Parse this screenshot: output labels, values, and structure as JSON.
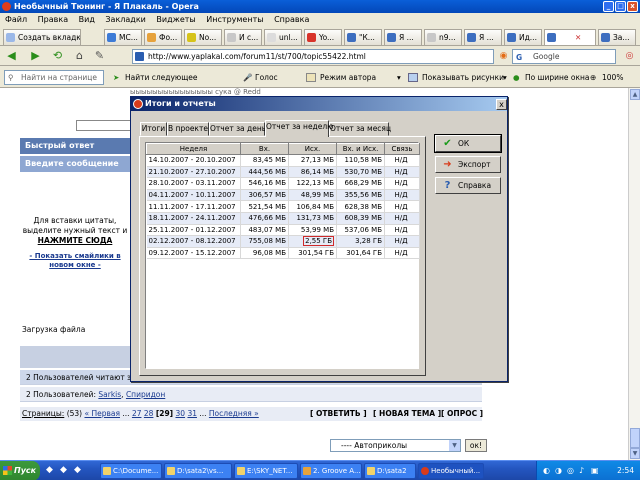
{
  "window": {
    "title": "Необычный Тюнинг - Я Плакаль - Opera",
    "controls": [
      "_",
      "□",
      "x"
    ]
  },
  "menu": [
    "Файл",
    "Правка",
    "Вид",
    "Закладки",
    "Виджеты",
    "Инструменты",
    "Справка"
  ],
  "tabs": {
    "create": "Создать вкладку",
    "items": [
      "MC...",
      "Фо...",
      "No...",
      "И с...",
      "unl...",
      "Yo...",
      "\"К...",
      "Я ...",
      "n9...",
      "Я ...",
      "Ид...",
      "За..."
    ]
  },
  "address": {
    "url": "http://www.yaplakal.com/forum11/st/700/topic55422.html",
    "search": "Google"
  },
  "findbar": {
    "placeholder": "Найти на странице",
    "find_next": "Найти следующее",
    "voice": "Голос",
    "author_mode": "Режим автора",
    "show_images": "Показывать рисунки",
    "fit_width": "По ширине окна",
    "zoom": "100%"
  },
  "page": {
    "top_text": "ыыыыыыыыыыыыыыы сука @ Redd",
    "quick_reply": "Быстрый ответ",
    "enter_message": "Введите сообщение",
    "quote_hint_1": "Для вставки цитаты,",
    "quote_hint_2": "выделите нужный текст и",
    "quote_hint_3": "НАЖМИТЕ СЮДА",
    "smilies_1": "- Показать смайлики в",
    "smilies_2": "новом окне -",
    "file_upload": "Загрузка файла",
    "users_reading": "2 Пользователей читают эту тему",
    "users_line": "2 Пользователей:",
    "user1": "Sarkis",
    "user2": "Спиридон",
    "pages_label": "Страницы:",
    "pages_count": "(53)",
    "prev": "« Первая",
    "dots": "...",
    "p27": "27",
    "p28": "28",
    "p29": "[29]",
    "p30": "30",
    "p31": "31",
    "last": "Последняя »",
    "answer": "[ ОТВЕТИТЬ ]",
    "new_topic": "[ НОВАЯ ТЕМА ]",
    "poll": "[ ОПРОС ]",
    "select_value": "---- Автоприколы",
    "ok_small": "ок!"
  },
  "dialog": {
    "title": "Итоги и отчеты",
    "close": "x",
    "tabs": [
      "Итоги",
      "В проекте",
      "Отчет за день",
      "Отчет за неделю",
      "Отчет за месяц"
    ],
    "selected_tab": "Отчет за неделю",
    "columns": [
      "Неделя",
      "Вх.",
      "Исх.",
      "Вх. и Исх.",
      "Связь"
    ],
    "rows": [
      [
        "14.10.2007 - 20.10.2007",
        "83,45 МБ",
        "27,13 МБ",
        "110,58 МБ",
        "Н/Д"
      ],
      [
        "21.10.2007 - 27.10.2007",
        "444,56 МБ",
        "86,14 МБ",
        "530,70 МБ",
        "Н/Д"
      ],
      [
        "28.10.2007 - 03.11.2007",
        "546,16 МБ",
        "122,13 МБ",
        "668,29 МБ",
        "Н/Д"
      ],
      [
        "04.11.2007 - 10.11.2007",
        "306,57 МБ",
        "48,99 МБ",
        "355,56 МБ",
        "Н/Д"
      ],
      [
        "11.11.2007 - 17.11.2007",
        "521,54 МБ",
        "106,84 МБ",
        "628,38 МБ",
        "Н/Д"
      ],
      [
        "18.11.2007 - 24.11.2007",
        "476,66 МБ",
        "131,73 МБ",
        "608,39 МБ",
        "Н/Д"
      ],
      [
        "25.11.2007 - 01.12.2007",
        "483,07 МБ",
        "53,99 МБ",
        "537,06 МБ",
        "Н/Д"
      ],
      [
        "02.12.2007 - 08.12.2007",
        "755,08 МБ",
        "2,55 ГБ",
        "3,28 ГБ",
        "Н/Д"
      ],
      [
        "09.12.2007 - 15.12.2007",
        "96,08 МБ",
        "301,54 ГБ",
        "301,64 ГБ",
        "Н/Д"
      ]
    ],
    "buttons": {
      "ok": "ОК",
      "export": "Экспорт",
      "help": "Справка"
    }
  },
  "taskbar": {
    "start": "Пуск",
    "items": [
      "C:\\Docume...",
      "D:\\sata2\\vs...",
      "E:\\SKY_NET...",
      "2. Groove A...",
      "D:\\sata2",
      "Необычный..."
    ],
    "clock": "2:54"
  }
}
